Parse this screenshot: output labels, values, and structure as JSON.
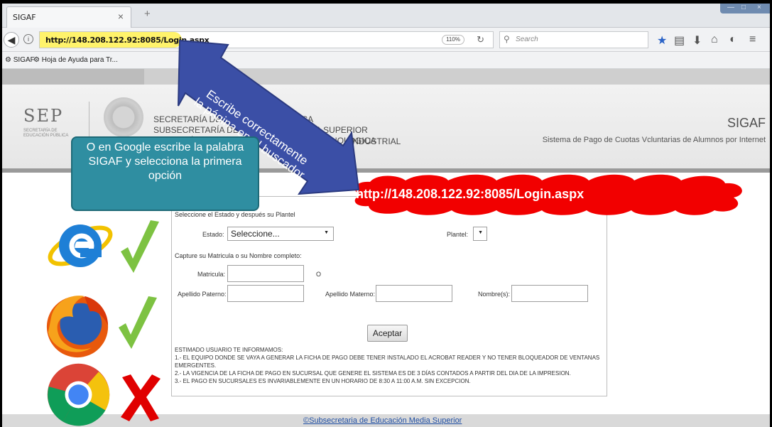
{
  "browser": {
    "tab_title": "SIGAF",
    "tab_close": "×",
    "new_tab": "+",
    "url": "http://148.208.122.92:8085/Login.aspx",
    "zoom": "110%",
    "search_placeholder": "Search",
    "bookmarks": [
      "SIGAF",
      "Hoja de Ayuda para Tr..."
    ],
    "window_controls": [
      "—",
      "□",
      "×"
    ]
  },
  "header": {
    "logo_text": "SEP",
    "logo_subtext": "SECRETARÍA DE EDUCACIÓN PÚBLICA",
    "line1": "SECRETARÍA DE EDUCACIÓN PÚBLICA",
    "line2": "SUBSECRETARÍA DE EDUCACIÓN MEDIA SUPERIOR",
    "line3": "DIRECCIÓN GENERAL DE EDUCACIÓN TECNOLÓGICA",
    "line_industrial": "INDUSTRIAL",
    "app_title": "SIGAF",
    "app_subtitle": "Sistema de Pago de Cuotas Vcluntarias de Alumnos por Internet"
  },
  "form": {
    "instruction1": "Seleccione el Estado y después su Plantel",
    "estado_label": "Estado:",
    "estado_value": "Seleccione...",
    "plantel_label": "Plantel:",
    "instruction2": "Capture su Matricula o su Nombre completo:",
    "matricula_label": "Matricula:",
    "o_label": "O",
    "apellido_paterno_label": "Apellido Paterno:",
    "apellido_materno_label": "Apellido Materno:",
    "nombre_label": "Nombre(s):",
    "submit_label": "Aceptar",
    "notice_title": "ESTIMADO USUARIO TE INFORMAMOS:",
    "notice_1": "1.- EL EQUIPO DONDE SE VAYA A GENERAR LA FICHA DE PAGO DEBE TENER INSTALADO EL ACROBAT READER Y NO TENER BLOQUEADOR DE VENTANAS EMERGENTES.",
    "notice_2": "2.- LA VIGENCIA DE LA FICHA DE PAGO EN SUCURSAL QUE GENERE EL SISTEMA ES DE 3 DÍAS CONTADOS A PARTIR DEL DIA DE LA IMPRESION.",
    "notice_3": "3.- EL PAGO EN SUCURSALES ES INVARIABLEMENTE EN UN HORARIO DE 8:30 A 11:00 A.M. SIN EXCEPCION."
  },
  "footer": {
    "copyright": "©",
    "link": "Subsecretaria de Educación Media Superior"
  },
  "annotations": {
    "arrow_text_line1": "Escribe correctamente",
    "arrow_text_line2": "la página en el buscador",
    "cloud_url": "http://148.208.122.92:8085/Login.aspx",
    "google_tip": "O en Google escribe la palabra SIGAF y selecciona la primera opción"
  },
  "colors": {
    "arrow": "#3b4fa6",
    "cloud": "#f20000",
    "tip_box": "#2f8ea1",
    "check": "#7dc242",
    "cross": "#e00000",
    "url_highlight": "#fff36b"
  },
  "icons": [
    "internet-explorer-icon",
    "firefox-icon",
    "chrome-icon",
    "checkmark-icon",
    "x-mark-icon"
  ]
}
